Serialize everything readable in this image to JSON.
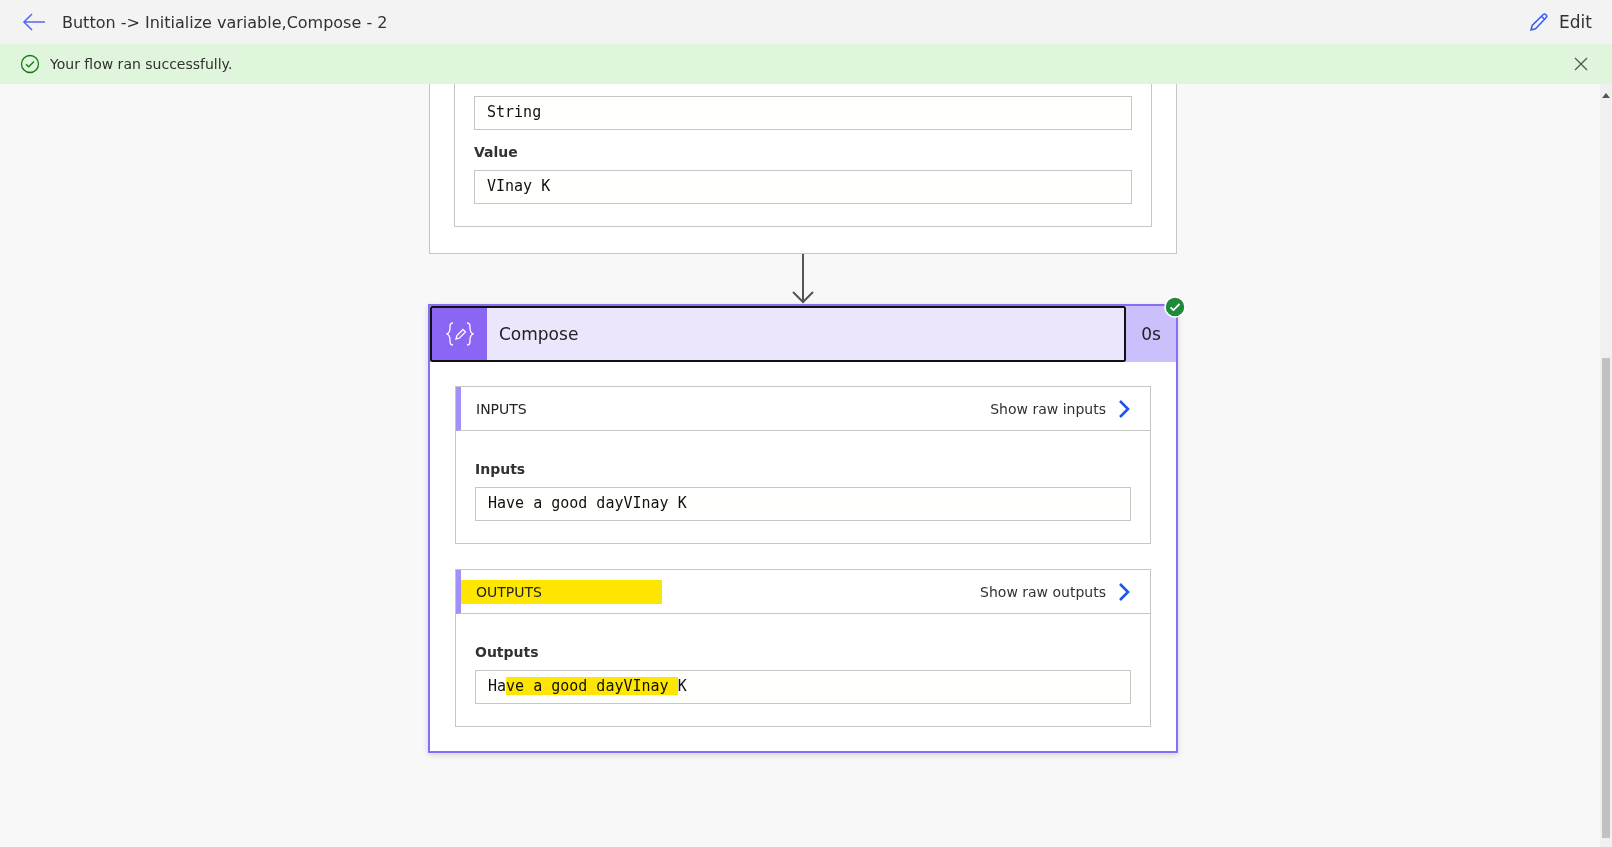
{
  "header": {
    "title": "Button -> Initialize variable,Compose - 2",
    "edit_label": "Edit"
  },
  "banner": {
    "message": "Your flow ran successfully."
  },
  "previous_step": {
    "fields": [
      {
        "value": "String"
      },
      {
        "label": "Value",
        "value": "VInay K"
      }
    ]
  },
  "compose": {
    "title": "Compose",
    "duration": "0s",
    "succeeded": true,
    "sections": [
      {
        "heading": "INPUTS",
        "heading_highlighted": false,
        "raw_link": "Show raw inputs",
        "field_label": "Inputs",
        "value_segments": [
          {
            "text": "Have a good dayVInay K",
            "highlighted": false
          }
        ]
      },
      {
        "heading": "OUTPUTS",
        "heading_highlighted": true,
        "raw_link": "Show raw outputs",
        "field_label": "Outputs",
        "value_segments": [
          {
            "text": "Ha",
            "highlighted": false
          },
          {
            "text": "ve a good dayVInay ",
            "highlighted": true
          },
          {
            "text": "K",
            "highlighted": false
          }
        ]
      }
    ]
  }
}
